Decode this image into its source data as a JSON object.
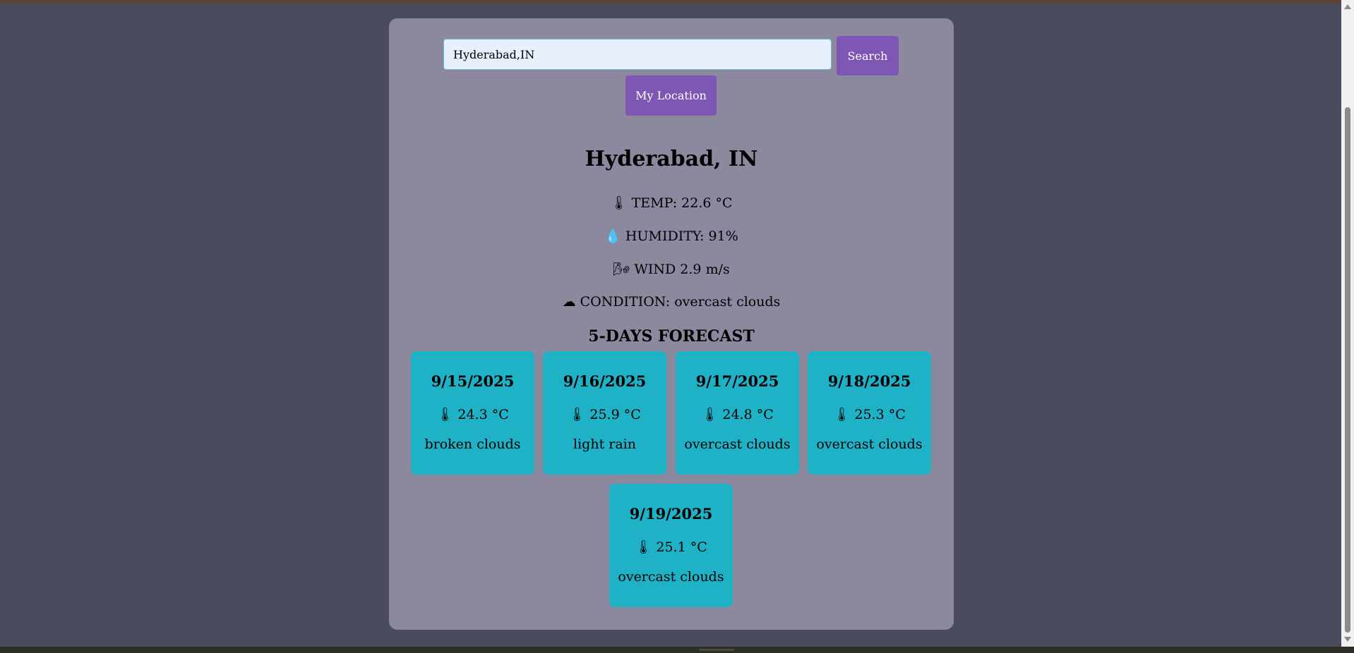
{
  "search": {
    "value": "Hyderabad,IN",
    "button_label": "Search"
  },
  "location_button_label": "My Location",
  "weather": {
    "city": "Hyderabad, IN",
    "temp": "TEMP: 22.6 °C",
    "humidity": "HUMIDITY: 91%",
    "wind": "WIND 2.9 m/s",
    "condition": "CONDITION: overcast clouds",
    "icons": {
      "temp": "🌡",
      "humidity": "💧",
      "wind": "🌬",
      "condition": "☁"
    }
  },
  "forecast": {
    "title": "5-DAYS FORECAST",
    "temp_icon": "🌡",
    "days": [
      {
        "date": "9/15/2025",
        "temp": "24.3 °C",
        "desc": "broken clouds"
      },
      {
        "date": "9/16/2025",
        "temp": "25.9 °C",
        "desc": "light rain"
      },
      {
        "date": "9/17/2025",
        "temp": "24.8 °C",
        "desc": "overcast clouds"
      },
      {
        "date": "9/18/2025",
        "temp": "25.3 °C",
        "desc": "overcast clouds"
      },
      {
        "date": "9/19/2025",
        "temp": "25.1 °C",
        "desc": "overcast clouds"
      }
    ]
  },
  "colors": {
    "page_bg": "#4a4c5e",
    "card_bg": "#8c889e",
    "button": "#7e57b5",
    "forecast_card": "#1fb1c6"
  }
}
